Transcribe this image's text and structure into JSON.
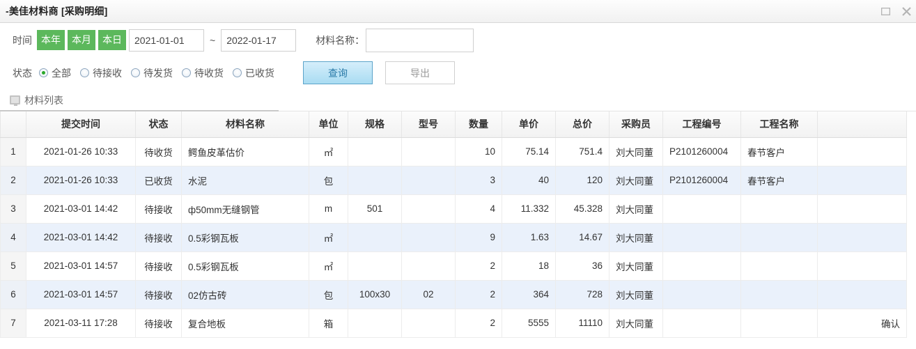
{
  "window": {
    "title": "-美佳材料商 [采购明细]",
    "maximize_icon": "maximize-icon",
    "close_icon": "close-icon"
  },
  "filters": {
    "time_label": "时间",
    "quick_buttons": [
      {
        "label": "本年",
        "name": "this-year"
      },
      {
        "label": "本月",
        "name": "this-month"
      },
      {
        "label": "本日",
        "name": "this-day"
      }
    ],
    "date_from": "2021-01-01",
    "date_to": "2022-01-17",
    "date_separator": "~",
    "material_label": "材料名称：",
    "material_value": "",
    "material_placeholder": "",
    "status_label": "状态",
    "status_options": [
      {
        "label": "全部",
        "checked": true
      },
      {
        "label": "待接收",
        "checked": false
      },
      {
        "label": "待发货",
        "checked": false
      },
      {
        "label": "待收货",
        "checked": false
      },
      {
        "label": "已收货",
        "checked": false
      }
    ],
    "query_button": "查询",
    "export_button": "导出",
    "accent_green": "#5cb85c",
    "accent_blue": "#a9dcf2"
  },
  "tabs": [
    {
      "label": "材料列表",
      "icon": "monitor-icon",
      "active": true
    }
  ],
  "table": {
    "headers": [
      "",
      "提交时间",
      "状态",
      "材料名称",
      "单位",
      "规格",
      "型号",
      "数量",
      "单价",
      "总价",
      "采购员",
      "工程编号",
      "工程名称",
      ""
    ],
    "rows": [
      {
        "index": "1",
        "time": "2021-01-26 10:33",
        "status": "待收货",
        "name": "鳄鱼皮革估价",
        "unit": "㎡",
        "spec": "",
        "model": "",
        "qty": "10",
        "price": "75.14",
        "total": "751.4",
        "buyer": "刘大同董",
        "project_no": "P2101260004",
        "project_name": "春节客户",
        "action": ""
      },
      {
        "index": "2",
        "time": "2021-01-26 10:33",
        "status": "已收货",
        "name": "水泥",
        "unit": "包",
        "spec": "",
        "model": "",
        "qty": "3",
        "price": "40",
        "total": "120",
        "buyer": "刘大同董",
        "project_no": "P2101260004",
        "project_name": "春节客户",
        "action": ""
      },
      {
        "index": "3",
        "time": "2021-03-01 14:42",
        "status": "待接收",
        "name": "ф50mm无缝钢管",
        "unit": "m",
        "spec": "501",
        "model": "",
        "qty": "4",
        "price": "11.332",
        "total": "45.328",
        "buyer": "刘大同董",
        "project_no": "",
        "project_name": "",
        "action": ""
      },
      {
        "index": "4",
        "time": "2021-03-01 14:42",
        "status": "待接收",
        "name": "0.5彩钢瓦板",
        "unit": "㎡",
        "spec": "",
        "model": "",
        "qty": "9",
        "price": "1.63",
        "total": "14.67",
        "buyer": "刘大同董",
        "project_no": "",
        "project_name": "",
        "action": ""
      },
      {
        "index": "5",
        "time": "2021-03-01 14:57",
        "status": "待接收",
        "name": "0.5彩钢瓦板",
        "unit": "㎡",
        "spec": "",
        "model": "",
        "qty": "2",
        "price": "18",
        "total": "36",
        "buyer": "刘大同董",
        "project_no": "",
        "project_name": "",
        "action": ""
      },
      {
        "index": "6",
        "time": "2021-03-01 14:57",
        "status": "待接收",
        "name": "02仿古砖",
        "unit": "包",
        "spec": "100x30",
        "model": "02",
        "qty": "2",
        "price": "364",
        "total": "728",
        "buyer": "刘大同董",
        "project_no": "",
        "project_name": "",
        "action": ""
      },
      {
        "index": "7",
        "time": "2021-03-11 17:28",
        "status": "待接收",
        "name": "复合地板",
        "unit": "箱",
        "spec": "",
        "model": "",
        "qty": "2",
        "price": "5555",
        "total": "11110",
        "buyer": "刘大同董",
        "project_no": "",
        "project_name": "",
        "action": "确认"
      }
    ]
  }
}
